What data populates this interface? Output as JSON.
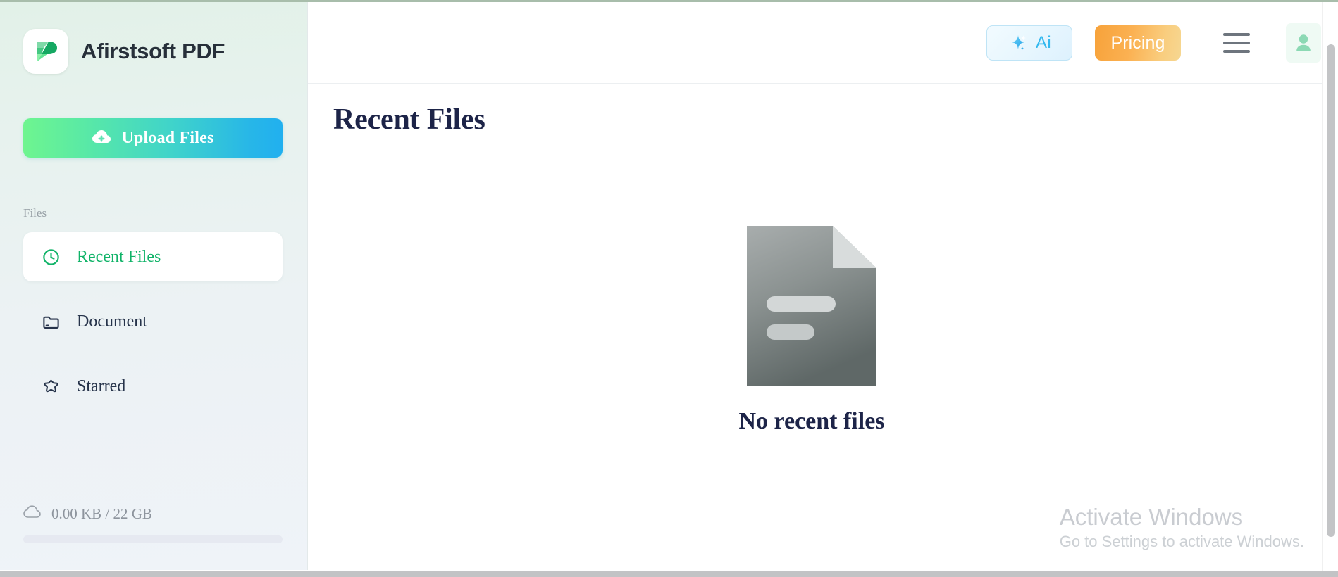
{
  "app": {
    "brand_name": "Afirstsoft PDF",
    "logo_icon": "afirstsoft-p-logo-icon"
  },
  "sidebar": {
    "upload": {
      "label": "Upload Files",
      "icon": "cloud-upload-icon"
    },
    "section_label": "Files",
    "items": [
      {
        "label": "Recent Files",
        "icon": "clock-icon",
        "active": true
      },
      {
        "label": "Document",
        "icon": "folder-icon",
        "active": false
      },
      {
        "label": "Starred",
        "icon": "star-icon",
        "active": false
      }
    ],
    "storage": {
      "icon": "cloud-icon",
      "text": "0.00 KB / 22 GB",
      "used": "0.00 KB",
      "total": "22 GB",
      "percent": 0
    }
  },
  "header": {
    "ai_button": {
      "label": "Ai",
      "icon": "sparkle-ai-icon"
    },
    "pricing_button": {
      "label": "Pricing"
    },
    "menu_button": {
      "icon": "hamburger-menu-icon"
    },
    "avatar": {
      "icon": "user-avatar-icon"
    }
  },
  "main": {
    "title": "Recent Files",
    "empty_state": {
      "icon": "document-placeholder-icon",
      "message": "No recent files"
    }
  },
  "watermark": {
    "title": "Activate Windows",
    "subtitle": "Go to Settings to activate Windows."
  },
  "colors": {
    "accent_green": "#10b368",
    "accent_blue": "#35b9ef",
    "pricing_orange": "#f7a23a",
    "title_navy": "#1d2448",
    "muted_gray": "#97a0a6"
  }
}
